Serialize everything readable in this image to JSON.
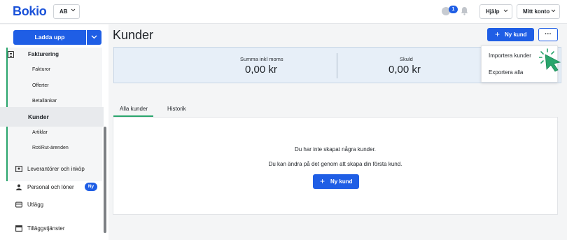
{
  "topbar": {
    "logo": "Bokio",
    "company": "AB",
    "notification_count": "1",
    "help_label": "Hjälp",
    "account_label": "Mitt konto"
  },
  "sidebar": {
    "upload_label": "Ladda upp",
    "group_title": "Fakturering",
    "sub_items": [
      "Fakturor",
      "Offerter",
      "Betallänkar",
      "Kunder",
      "Artiklar",
      "Rot/Rut-ärenden"
    ],
    "active_sub": "Kunder",
    "main_items": [
      {
        "label": "Leverantörer och inköp",
        "icon": "supplier-icon"
      },
      {
        "label": "Personal och löner",
        "icon": "person-icon",
        "badge": "Ny"
      },
      {
        "label": "Utlägg",
        "icon": "card-icon"
      },
      {
        "label": "Tilläggstjänster",
        "icon": "services-icon"
      }
    ]
  },
  "header": {
    "title": "Kunder",
    "new_customer_label": "Ny kund",
    "more_label": "..."
  },
  "summary": {
    "total_label": "Summa inkl moms",
    "total_value": "0,00 kr",
    "debt_label": "Skuld",
    "debt_value": "0,00 kr"
  },
  "dropdown": {
    "items": [
      "Importera kunder",
      "Exportera alla"
    ]
  },
  "tabs": [
    "Alla kunder",
    "Historik"
  ],
  "active_tab": "Alla kunder",
  "empty_state": {
    "line1": "Du har inte skapat några kunder.",
    "line2": "Du kan ändra på det genom att skapa din första kund.",
    "button_label": "Ny kund"
  },
  "colors": {
    "primary": "#1f5ee5",
    "accent_green": "#29a56c",
    "summary_bg": "#e7eff8"
  }
}
